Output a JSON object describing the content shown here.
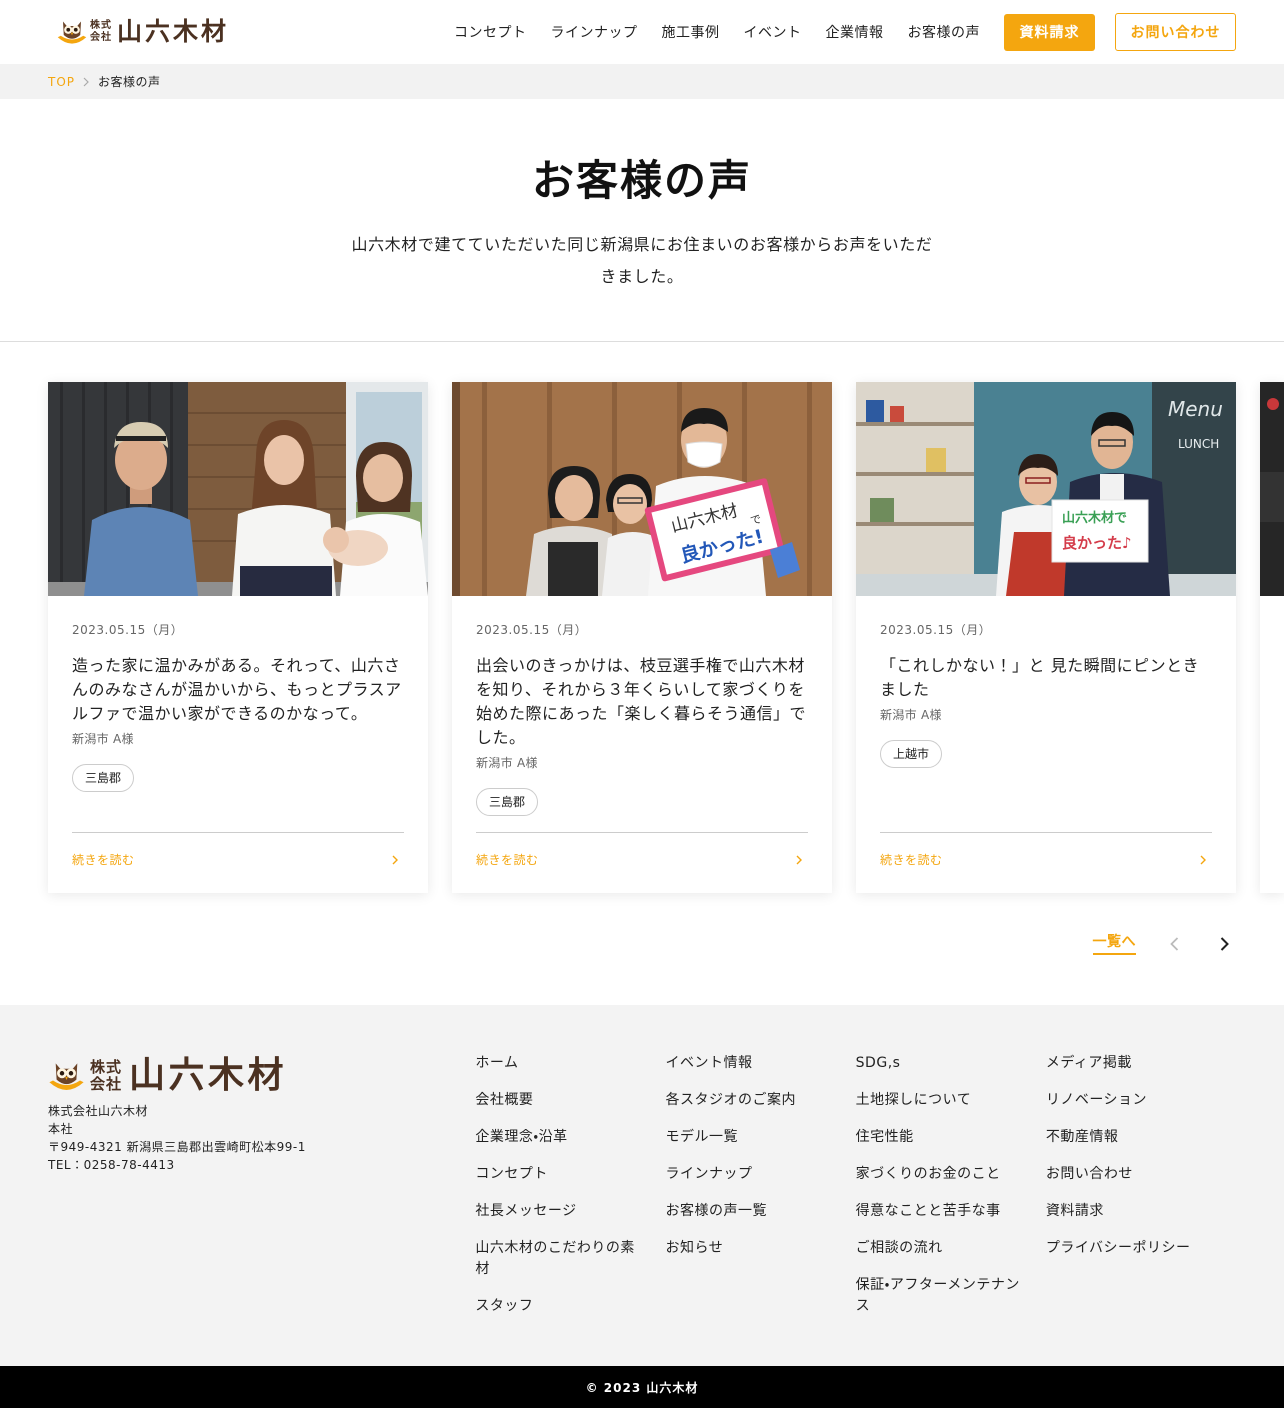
{
  "header": {
    "logo": {
      "corp_top": "株式",
      "corp_bottom": "会社",
      "name": "山六木材"
    },
    "nav": [
      "コンセプト",
      "ラインナップ",
      "施工事例",
      "イベント",
      "企業情報",
      "お客様の声"
    ],
    "request_button": "資料請求",
    "contact_button": "お問い合わせ"
  },
  "breadcrumb": {
    "home": "TOP",
    "current": "お客様の声"
  },
  "hero": {
    "title": "お客様の声",
    "lead": "山六木材で建てていただいた同じ新潟県にお住まいのお客様からお声をいただきました。"
  },
  "voices": {
    "cards": [
      {
        "date": "2023.05.15（月）",
        "title": "造った家に温かみがある。それって、山六さんのみなさんが温かいから、もっとプラスアルファで温かい家ができるのかなって。",
        "author": "新潟市 A様",
        "tag": "三島郡",
        "more": "続きを読む"
      },
      {
        "date": "2023.05.15（月）",
        "title": "出会いのきっかけは、枝豆選手権で山六木材を知り、それから３年くらいして家づくりを始めた際にあった「楽しく暮らそう通信」でした。",
        "author": "新潟市 A様",
        "tag": "三島郡",
        "more": "続きを読む",
        "photo_sign": [
          "山六木材",
          "で",
          "良かった!"
        ]
      },
      {
        "date": "2023.05.15（月）",
        "title": "「これしかない！」と 見た瞬間にピンときました",
        "author": "新潟市 A様",
        "tag": "上越市",
        "more": "続きを読む",
        "photo_sign": [
          "山六木材で",
          "良かった♪"
        ],
        "photo_board": [
          "Menu",
          "LUNCH"
        ]
      }
    ],
    "list_link": "一覧へ"
  },
  "footer": {
    "logo": {
      "corp_top": "株式",
      "corp_bottom": "会社",
      "name": "山六木材"
    },
    "company": "株式会社山六木材",
    "office": "本社",
    "address": "〒949-4321 新潟県三島郡出雲崎町松本99-1",
    "tel": "TEL：0258-78-4413",
    "columns": [
      [
        "ホーム",
        "会社概要",
        "企業理念・沿革",
        "コンセプト",
        "社長メッセージ",
        "山六木材のこだわりの素材",
        "スタッフ"
      ],
      [
        "イベント情報",
        "各スタジオのご案内",
        "モデル一覧",
        "ラインナップ",
        "お客様の声一覧",
        "お知らせ"
      ],
      [
        "SDG,s",
        "土地探しについて",
        "住宅性能",
        "家づくりのお金のこと",
        "得意なことと苦手な事",
        "ご相談の流れ",
        "保証・アフターメンテナンス"
      ],
      [
        "メディア掲載",
        "リノベーション",
        "不動産情報",
        "お問い合わせ",
        "資料請求",
        "プライバシーポリシー"
      ]
    ]
  },
  "copyright": "© 2023 山六木材",
  "colors": {
    "accent": "#f4a60f",
    "logo_brown": "#4b3121",
    "footer_bg": "#f3f3f3",
    "breadcrumb_bg": "#f2f2f2",
    "copyright_bg": "#000000"
  },
  "icons": {
    "logo": "owl-icon",
    "breadcrumb_separator": "chevron-right-icon",
    "card_more": "chevron-right-icon",
    "pager_prev": "chevron-left-icon",
    "pager_next": "chevron-right-icon"
  }
}
